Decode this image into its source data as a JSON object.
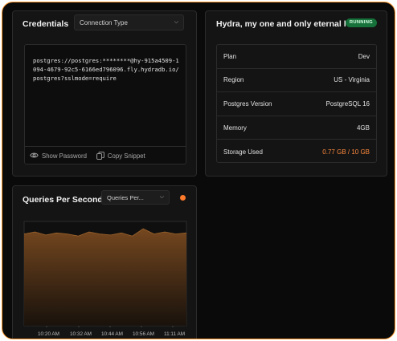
{
  "credentials": {
    "title": "Credentials",
    "connection_type_select": "Connection Type",
    "connection_string": "postgres://postgres:********@hy-915a4509-1094-4679-92c5-6166ed796096.fly.hydradb.io/postgres?sslmode=require",
    "show_password_label": "Show Password",
    "copy_snippet_label": "Copy Snippet"
  },
  "database": {
    "name": "Hydra, my one and only eternal love",
    "status_badge": "RUNNING",
    "status_color": "#16713a",
    "details": [
      {
        "label": "Plan",
        "value": "Dev"
      },
      {
        "label": "Region",
        "value": "US - Virginia"
      },
      {
        "label": "Postgres Version",
        "value": "PostgreSQL 16"
      },
      {
        "label": "Memory",
        "value": "4GB"
      },
      {
        "label": "Storage Used",
        "value": "0.77 GB / 10 GB",
        "highlight_color": "#ff8a3d"
      }
    ]
  },
  "queries_panel": {
    "title": "Queries Per Second",
    "metric_select": "Queries Per...",
    "status_dot_color": "#ff7a2a"
  },
  "chart_data": {
    "type": "area",
    "title": "",
    "xlabel": "",
    "ylabel": "",
    "x_ticks": [
      "10:20 AM",
      "10:32 AM",
      "10:44 AM",
      "10:56 AM",
      "11:11 AM"
    ],
    "x": [
      "10:14 AM",
      "10:18 AM",
      "10:22 AM",
      "10:26 AM",
      "10:30 AM",
      "10:34 AM",
      "10:38 AM",
      "10:42 AM",
      "10:46 AM",
      "10:50 AM",
      "10:54 AM",
      "10:58 AM",
      "11:02 AM",
      "11:06 AM",
      "11:10 AM",
      "11:14 AM"
    ],
    "series": [
      {
        "values": [
          0.88,
          0.9,
          0.87,
          0.89,
          0.88,
          0.86,
          0.9,
          0.88,
          0.87,
          0.89,
          0.86,
          0.93,
          0.88,
          0.9,
          0.88,
          0.89
        ],
        "color": "#7a4a20"
      }
    ],
    "ylim": [
      0,
      1
    ],
    "grid": false,
    "legend": "none"
  },
  "colors": {
    "accent": "#ff9a2e",
    "background": "#0a0a0a",
    "panel": "#141414"
  }
}
